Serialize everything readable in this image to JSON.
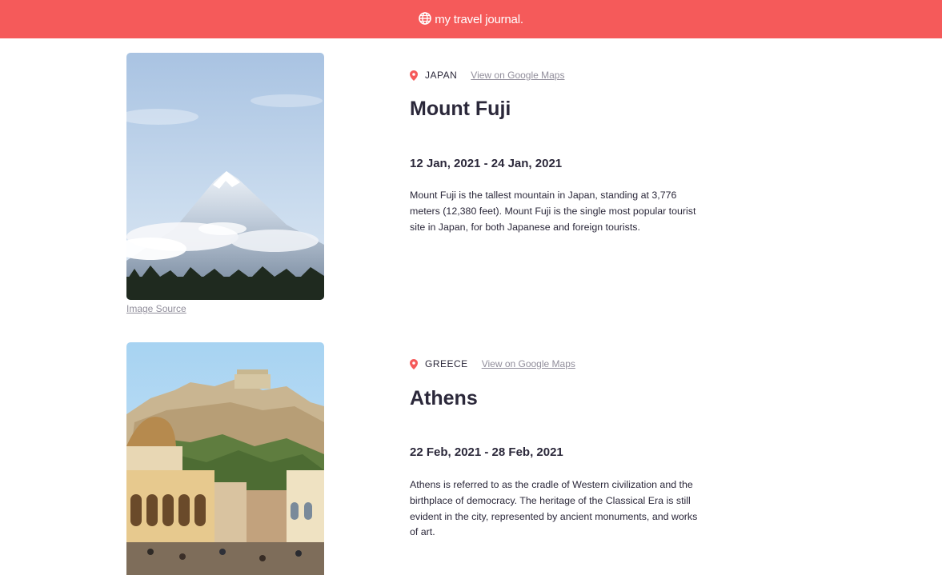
{
  "header": {
    "title": "my travel journal.",
    "icon": "globe-icon",
    "background": "#f55a5a"
  },
  "entries": [
    {
      "image_alt": "Mount Fuji snow-capped peak",
      "image_source_label": "Image Source",
      "location_icon": "map-pin-icon",
      "country": "JAPAN",
      "maps_link_label": "View on Google Maps",
      "title": "Mount Fuji",
      "dates": "12 Jan, 2021 - 24 Jan, 2021",
      "description": "Mount Fuji is the tallest mountain in Japan, standing at 3,776 meters (12,380 feet). Mount Fuji is the single most popular tourist site in Japan, for both Japanese and foreign tourists."
    },
    {
      "image_alt": "Athens city with Acropolis",
      "location_icon": "map-pin-icon",
      "country": "GREECE",
      "maps_link_label": "View on Google Maps",
      "title": "Athens",
      "dates": "22 Feb, 2021 - 28 Feb, 2021",
      "description": "Athens is referred to as the cradle of Western civilization and the birthplace of democracy. The heritage of the Classical Era is still evident in the city, represented by ancient monuments, and works of art."
    }
  ],
  "colors": {
    "accent": "#f55a5a",
    "text": "#2b283a",
    "muted": "#918e9b"
  }
}
